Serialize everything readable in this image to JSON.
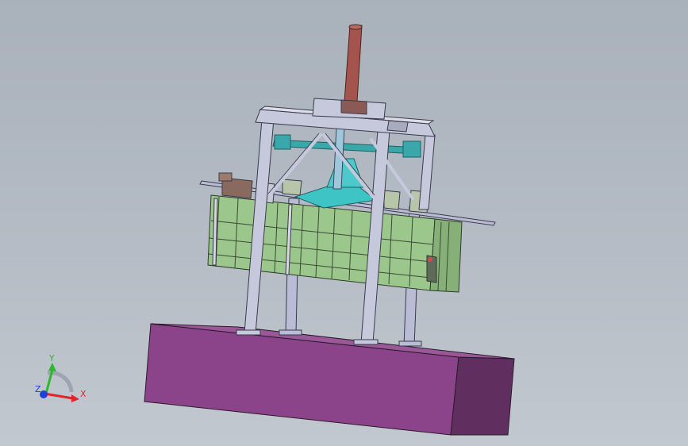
{
  "viewport": {
    "background_top": "#a9b1bb",
    "background_bottom": "#c2c8cf"
  },
  "model": {
    "base_color": "#8b4489",
    "base_side_color": "#612f5f",
    "frame_color": "#b9bcd4",
    "tank_color": "#9bc68c",
    "cone_color": "#3fc4c6",
    "rod_color": "#a4544d"
  },
  "triad": {
    "x_label": "X",
    "y_label": "Y",
    "z_label": "Z",
    "x_color": "#e0262a",
    "y_color": "#2fb82f",
    "z_color": "#1f3fd6"
  }
}
